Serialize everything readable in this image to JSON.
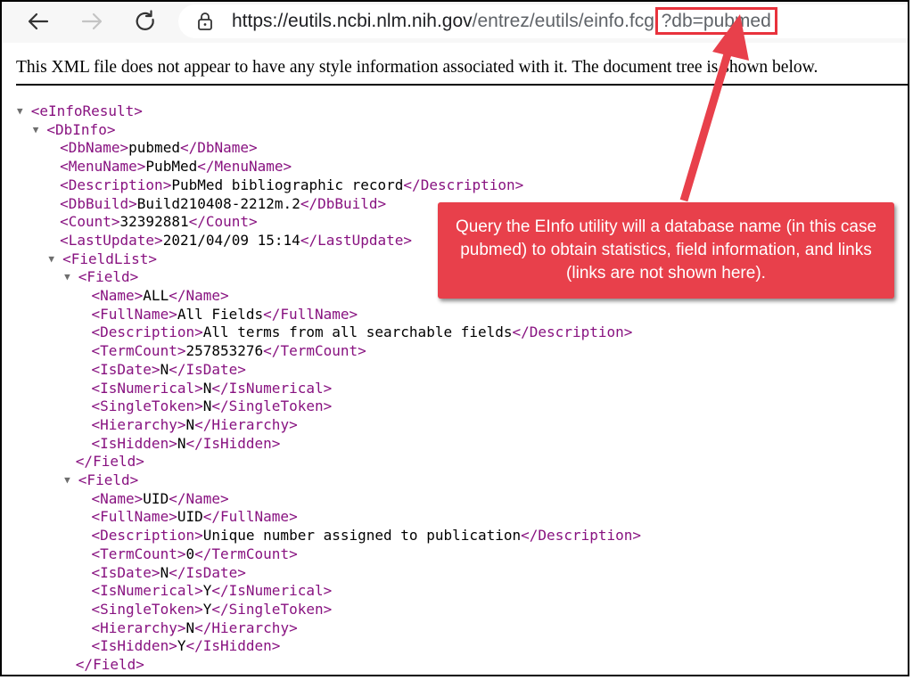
{
  "browser": {
    "url_host": "https://eutils.ncbi.nlm.nih.gov",
    "url_path": "/entrez/eutils/einfo.fcgi",
    "url_query": "?db=pubmed",
    "accent_highlight": "#e8323c"
  },
  "xml_notice": "This XML file does not appear to have any style information associated with it. The document tree is shown below.",
  "xml": {
    "root_open": "<eInfoResult>",
    "dbinfo_open": "<DbInfo>",
    "dbinfo": [
      {
        "open": "<DbName>",
        "value": "pubmed",
        "close": "</DbName>"
      },
      {
        "open": "<MenuName>",
        "value": "PubMed",
        "close": "</MenuName>"
      },
      {
        "open": "<Description>",
        "value": "PubMed bibliographic record",
        "close": "</Description>"
      },
      {
        "open": "<DbBuild>",
        "value": "Build210408-2212m.2",
        "close": "</DbBuild>"
      },
      {
        "open": "<Count>",
        "value": "32392881",
        "close": "</Count>"
      },
      {
        "open": "<LastUpdate>",
        "value": "2021/04/09 15:14",
        "close": "</LastUpdate>"
      }
    ],
    "fieldlist_open": "<FieldList>",
    "field_open": "<Field>",
    "field_close": "</Field>",
    "fields": [
      [
        {
          "open": "<Name>",
          "value": "ALL",
          "close": "</Name>"
        },
        {
          "open": "<FullName>",
          "value": "All Fields",
          "close": "</FullName>"
        },
        {
          "open": "<Description>",
          "value": "All terms from all searchable fields",
          "close": "</Description>"
        },
        {
          "open": "<TermCount>",
          "value": "257853276",
          "close": "</TermCount>"
        },
        {
          "open": "<IsDate>",
          "value": "N",
          "close": "</IsDate>"
        },
        {
          "open": "<IsNumerical>",
          "value": "N",
          "close": "</IsNumerical>"
        },
        {
          "open": "<SingleToken>",
          "value": "N",
          "close": "</SingleToken>"
        },
        {
          "open": "<Hierarchy>",
          "value": "N",
          "close": "</Hierarchy>"
        },
        {
          "open": "<IsHidden>",
          "value": "N",
          "close": "</IsHidden>"
        }
      ],
      [
        {
          "open": "<Name>",
          "value": "UID",
          "close": "</Name>"
        },
        {
          "open": "<FullName>",
          "value": "UID",
          "close": "</FullName>"
        },
        {
          "open": "<Description>",
          "value": "Unique number assigned to publication",
          "close": "</Description>"
        },
        {
          "open": "<TermCount>",
          "value": "0",
          "close": "</TermCount>"
        },
        {
          "open": "<IsDate>",
          "value": "N",
          "close": "</IsDate>"
        },
        {
          "open": "<IsNumerical>",
          "value": "Y",
          "close": "</IsNumerical>"
        },
        {
          "open": "<SingleToken>",
          "value": "Y",
          "close": "</SingleToken>"
        },
        {
          "open": "<Hierarchy>",
          "value": "N",
          "close": "</Hierarchy>"
        },
        {
          "open": "<IsHidden>",
          "value": "Y",
          "close": "</IsHidden>"
        }
      ]
    ],
    "tag_color": "#881280"
  },
  "callout": {
    "text": "Query the EInfo utility will a database name (in this case pubmed) to obtain statistics, field information, and links (links are not shown here).",
    "color": "#e8404b"
  }
}
